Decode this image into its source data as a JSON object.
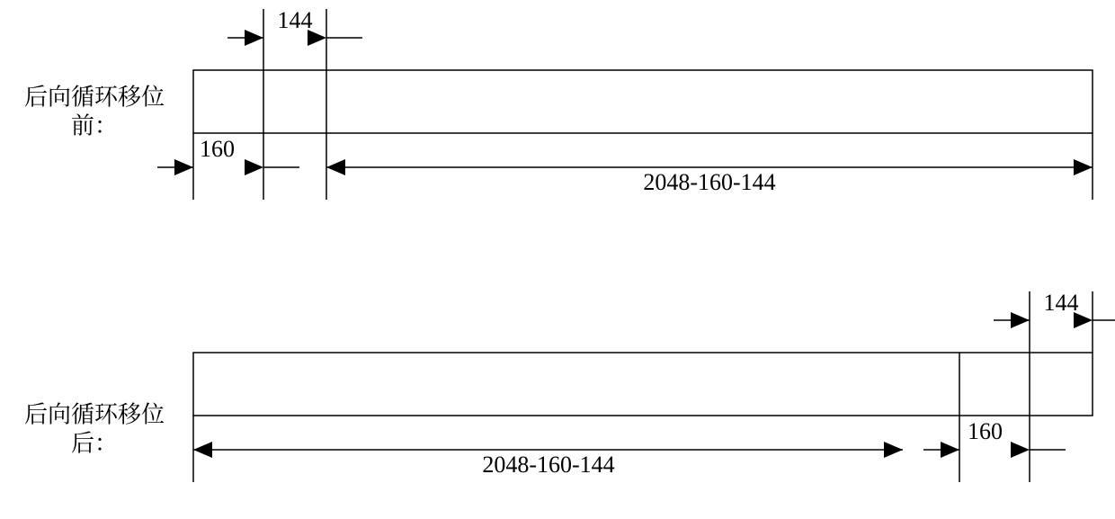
{
  "labels": {
    "before_line1": "后向循环移位",
    "before_line2": "前：",
    "after_line1": "后向循环移位",
    "after_line2": "后："
  },
  "values": {
    "seg_144": "144",
    "seg_160": "160",
    "seg_main": "2048-160-144"
  },
  "chart_data": {
    "type": "diagram",
    "title": "后向循环移位 (Backward cyclic shift)",
    "total_length": 2048,
    "segments": [
      {
        "name": "160",
        "length": 160
      },
      {
        "name": "144",
        "length": 144
      },
      {
        "name": "remainder",
        "length": 1744,
        "label": "2048-160-144"
      }
    ],
    "states": [
      {
        "label": "后向循环移位前 (before)",
        "order": [
          "160",
          "144",
          "remainder"
        ]
      },
      {
        "label": "后向循环移位后 (after)",
        "order": [
          "remainder",
          "160",
          "144"
        ]
      }
    ]
  }
}
